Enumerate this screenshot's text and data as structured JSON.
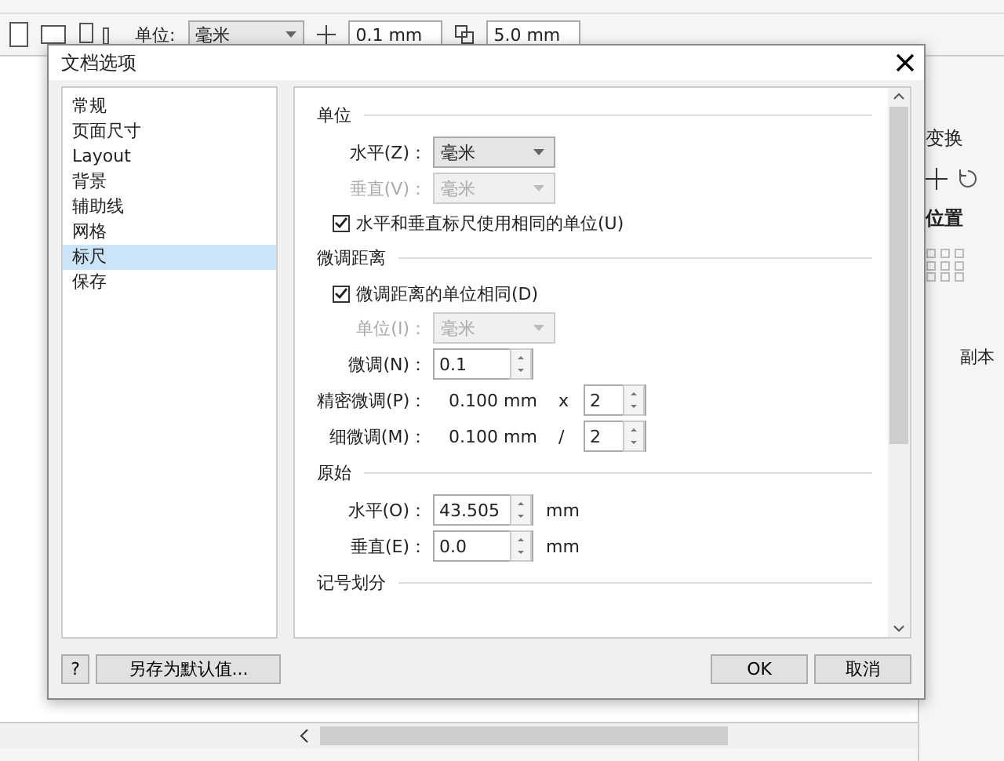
{
  "app": {
    "toolbar": {
      "unit_label": "单位:",
      "unit_value": "毫米",
      "nudge": "0.1 mm",
      "duplicate": "5.0 mm"
    },
    "docker": {
      "title": "变换",
      "section": "位置",
      "copies_label": "副本"
    }
  },
  "dialog": {
    "title": "文档选项",
    "categories": [
      {
        "label": "常规",
        "selected": false
      },
      {
        "label": "页面尺寸",
        "selected": false
      },
      {
        "label": "Layout",
        "selected": false
      },
      {
        "label": "背景",
        "selected": false
      },
      {
        "label": "辅助线",
        "selected": false
      },
      {
        "label": "网格",
        "selected": false
      },
      {
        "label": "标尺",
        "selected": true
      },
      {
        "label": "保存",
        "selected": false
      }
    ],
    "sections": [
      {
        "title": "单位",
        "rows": [
          {
            "kind": "dropdown",
            "label": "水平(Z)：",
            "value": "毫米",
            "disabled": false
          },
          {
            "kind": "dropdown",
            "label": "垂直(V)：",
            "value": "毫米",
            "disabled": true
          },
          {
            "kind": "checkbox",
            "label": "水平和垂直标尺使用相同的单位(U)",
            "checked": true
          }
        ]
      },
      {
        "title": "微调距离",
        "rows": [
          {
            "kind": "checkbox",
            "label": "微调距离的单位相同(D)",
            "checked": true
          },
          {
            "kind": "dropdown",
            "label": "单位(I)：",
            "value": "毫米",
            "disabled": true
          },
          {
            "kind": "spin",
            "label": "微调(N)：",
            "value": "0.1"
          },
          {
            "kind": "computed",
            "label": "精密微调(P)：",
            "reading": "0.100 mm",
            "operator": "x",
            "value": "2"
          },
          {
            "kind": "computed",
            "label": "细微调(M)：",
            "reading": "0.100 mm",
            "operator": "/",
            "value": "2"
          }
        ]
      },
      {
        "title": "原始",
        "rows": [
          {
            "kind": "spin",
            "label": "水平(O)：",
            "value": "43.505",
            "unit": "mm"
          },
          {
            "kind": "spin",
            "label": "垂直(E)：",
            "value": "0.0",
            "unit": "mm"
          }
        ]
      },
      {
        "title": "记号划分"
      }
    ],
    "help_button": "?",
    "save_default_button": "另存为默认值...",
    "ok_button": "OK",
    "cancel_button": "取消"
  }
}
